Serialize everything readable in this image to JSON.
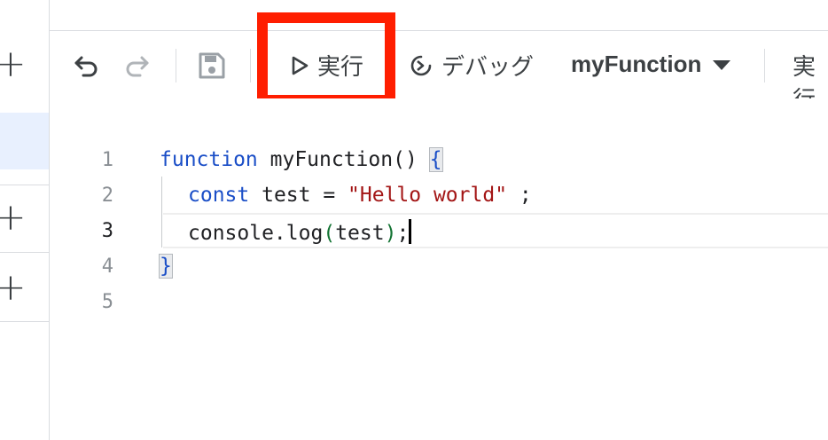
{
  "toolbar": {
    "undo_icon": "undo-icon",
    "redo_icon": "redo-icon",
    "save_icon": "save-icon",
    "run_label": "実行",
    "debug_label": "デバッグ",
    "function_select": "myFunction",
    "exec_log_label": "実行"
  },
  "sidebar": {
    "add_buttons": [
      "+",
      "+",
      "+"
    ]
  },
  "editor": {
    "line_numbers": [
      "1",
      "2",
      "3",
      "4",
      "5"
    ],
    "active_line": "3",
    "lines": {
      "l1_kw": "function",
      "l1_name": " myFunction() ",
      "l1_brace": "{",
      "l2_kw": "const",
      "l2_mid": " test = ",
      "l2_str": "\"Hello world\"",
      "l2_end": " ;",
      "l3_a": "console.log",
      "l3_open": "(",
      "l3_arg": "test",
      "l3_close": ")",
      "l3_end": ";",
      "l4_brace": "}"
    }
  },
  "colors": {
    "highlight": "#ff1e00",
    "keyword": "#1a4ec7",
    "string": "#a31515",
    "paren": "#137333"
  }
}
